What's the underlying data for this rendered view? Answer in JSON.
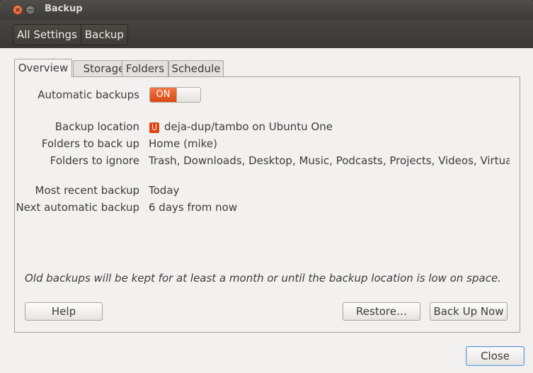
{
  "window": {
    "title": "Backup",
    "close_glyph": "×",
    "minimize_glyph": "−"
  },
  "breadcrumb": {
    "items": [
      "All Settings",
      "Backup"
    ]
  },
  "tabs": [
    {
      "label": "Overview",
      "active": true
    },
    {
      "label": "Storage",
      "active": false
    },
    {
      "label": "Folders",
      "active": false
    },
    {
      "label": "Schedule",
      "active": false
    }
  ],
  "overview": {
    "automatic_backups_label": "Automatic backups",
    "switch_text": "ON",
    "switch_state": true,
    "backup_location_label": "Backup location",
    "backup_location_value": "deja-dup/tambo on Ubuntu One",
    "backup_location_icon": "ubuntu-one-icon",
    "folders_backup_label": "Folders to back up",
    "folders_backup_value": "Home (mike)",
    "folders_ignore_label": "Folders to ignore",
    "folders_ignore_value": "Trash, Downloads, Desktop, Music, Podcasts, Projects, Videos, Virtual…",
    "recent_label": "Most recent backup",
    "recent_value": "Today",
    "next_label": "Next automatic backup",
    "next_value": "6 days from now",
    "note": "Old backups will be kept for at least a month or until the backup location is low on space."
  },
  "buttons": {
    "help": "Help",
    "restore": "Restore…",
    "backup_now": "Back Up Now",
    "close": "Close"
  },
  "colors": {
    "accent": "#dd4814",
    "titlebar": "#3c3b37",
    "window_bg": "#f2f1f0"
  }
}
